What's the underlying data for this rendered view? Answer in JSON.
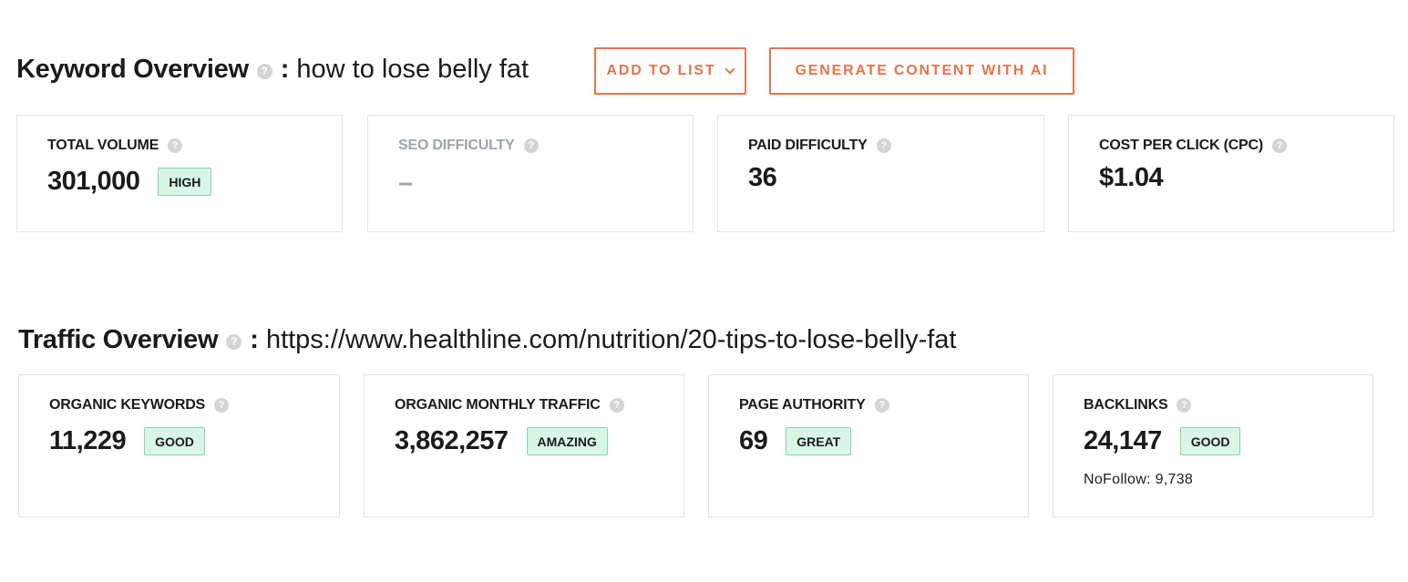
{
  "keyword_overview": {
    "title": "Keyword Overview",
    "help": "?",
    "colon": ":",
    "keyword": "how to lose belly fat",
    "add_to_list_label": "ADD TO LIST",
    "generate_label": "GENERATE CONTENT WITH AI",
    "cards": [
      {
        "label": "TOTAL VOLUME",
        "value": "301,000",
        "badge": "HIGH"
      },
      {
        "label": "SEO DIFFICULTY",
        "value": "–"
      },
      {
        "label": "PAID DIFFICULTY",
        "value": "36"
      },
      {
        "label": "COST PER CLICK (CPC)",
        "value": "$1.04"
      }
    ]
  },
  "traffic_overview": {
    "title": "Traffic Overview",
    "help": "?",
    "colon": ":",
    "url": "https://www.healthline.com/nutrition/20-tips-to-lose-belly-fat",
    "cards": [
      {
        "label": "ORGANIC KEYWORDS",
        "value": "11,229",
        "badge": "GOOD"
      },
      {
        "label": "ORGANIC MONTHLY TRAFFIC",
        "value": "3,862,257",
        "badge": "AMAZING"
      },
      {
        "label": "PAGE AUTHORITY",
        "value": "69",
        "badge": "GREAT"
      },
      {
        "label": "BACKLINKS",
        "value": "24,147",
        "badge": "GOOD",
        "sub": "NoFollow: 9,738"
      }
    ]
  },
  "colors": {
    "accent": "#e2754d",
    "badge_bg": "#d9f5e6",
    "badge_border": "#87d5ae",
    "muted_text": "#9ea4a8",
    "card_border": "#e3e3e3"
  },
  "icons": {
    "help": "help-circle-icon",
    "dropdown": "chevron-down-icon"
  }
}
